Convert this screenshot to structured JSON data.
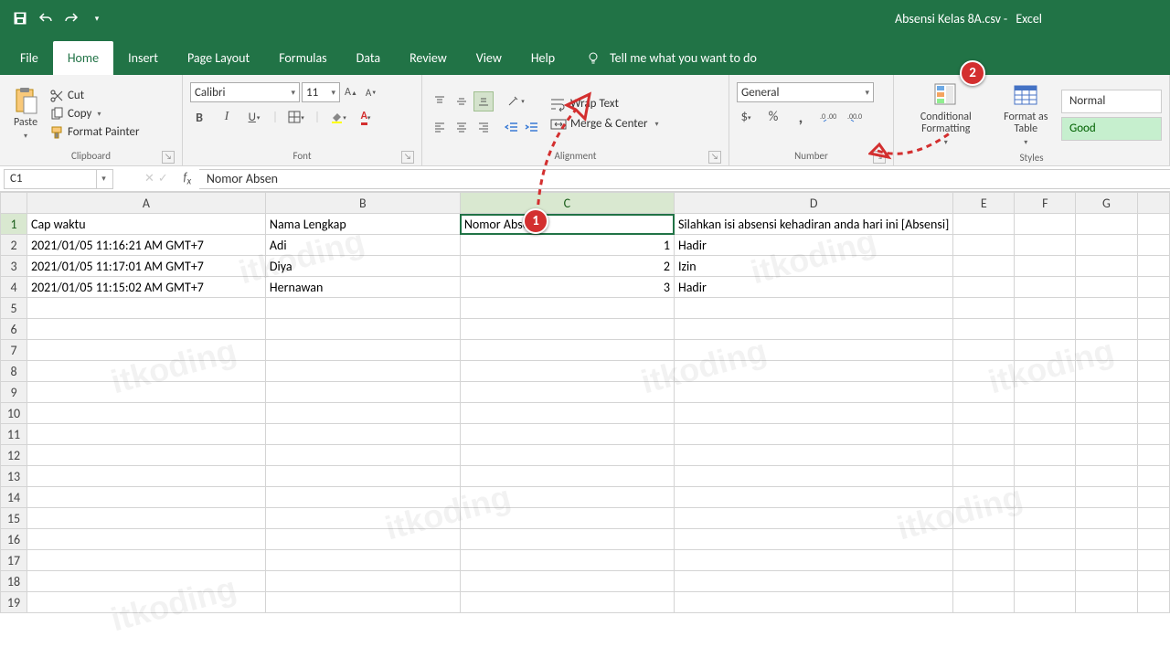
{
  "titlebar": {
    "filename": "Absensi Kelas 8A.csv",
    "app": "Excel"
  },
  "tabs": {
    "file": "File",
    "home": "Home",
    "insert": "Insert",
    "pagelayout": "Page Layout",
    "formulas": "Formulas",
    "data": "Data",
    "review": "Review",
    "view": "View",
    "help": "Help",
    "tellme": "Tell me what you want to do"
  },
  "clipboard": {
    "paste": "Paste",
    "cut": "Cut",
    "copy": "Copy",
    "formatpainter": "Format Painter",
    "label": "Clipboard"
  },
  "font": {
    "name": "Calibri",
    "size": "11",
    "label": "Font"
  },
  "alignment": {
    "wrap": "Wrap Text",
    "merge": "Merge & Center",
    "label": "Alignment"
  },
  "number": {
    "format": "General",
    "label": "Number"
  },
  "styles": {
    "conditional": "Conditional Formatting",
    "formatastable": "Format as Table",
    "normal": "Normal",
    "good": "Good",
    "label": "Styles"
  },
  "fx": {
    "cellref": "C1",
    "value": "Nomor Absen"
  },
  "columns": [
    "A",
    "B",
    "C",
    "D",
    "E",
    "F",
    "G"
  ],
  "rows": {
    "headers": {
      "A": "Cap waktu",
      "B": "Nama Lengkap",
      "C": "Nomor Absen",
      "D": "Silahkan isi absensi kehadiran anda hari ini [Absensi]"
    },
    "r2": {
      "A": "2021/01/05 11:16:21 AM GMT+7",
      "B": "Adi",
      "C": "1",
      "D": "Hadir"
    },
    "r3": {
      "A": "2021/01/05 11:17:01 AM GMT+7",
      "B": "Diya",
      "C": "2",
      "D": "Izin"
    },
    "r4": {
      "A": "2021/01/05 11:15:02 AM GMT+7",
      "B": "Hernawan",
      "C": "3",
      "D": "Hadir"
    }
  },
  "annotations": {
    "badge1": "1",
    "badge2": "2"
  },
  "watermark": "itkoding"
}
